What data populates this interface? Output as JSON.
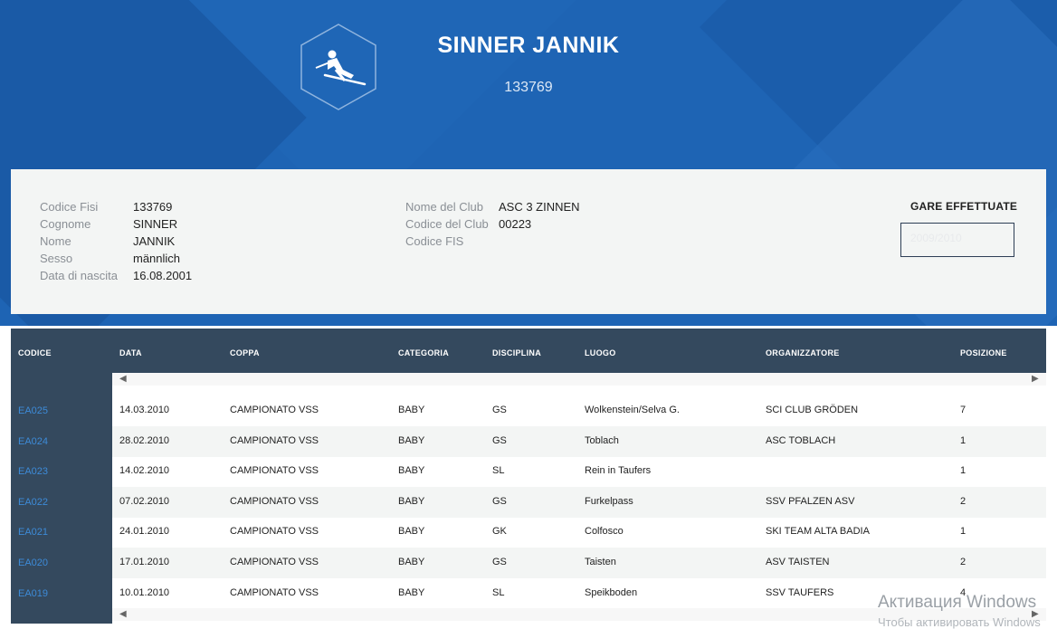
{
  "header": {
    "athlete_name": "SINNER JANNIK",
    "athlete_code": "133769"
  },
  "info": {
    "left": [
      {
        "label": "Codice Fisi",
        "value": "133769"
      },
      {
        "label": "Cognome",
        "value": "SINNER"
      },
      {
        "label": "Nome",
        "value": "JANNIK"
      },
      {
        "label": "Sesso",
        "value": "männlich"
      },
      {
        "label": "Data di nascita",
        "value": "16.08.2001"
      }
    ],
    "middle": [
      {
        "label": "Nome del Club",
        "value": "ASC 3 ZINNEN"
      },
      {
        "label": "Codice del Club",
        "value": "00223"
      },
      {
        "label": "Codice FIS",
        "value": ""
      }
    ],
    "gare_title": "GARE EFFETTUATE",
    "season_selected": "2009/2010"
  },
  "table": {
    "columns": [
      "CODICE",
      "DATA",
      "COPPA",
      "CATEGORIA",
      "DISCIPLINA",
      "LUOGO",
      "ORGANIZZATORE",
      "POSIZIONE"
    ],
    "rows": [
      {
        "codice": "EA025",
        "data": "14.03.2010",
        "coppa": "CAMPIONATO VSS",
        "categoria": "BABY",
        "disciplina": "GS",
        "luogo": "Wolkenstein/Selva G.",
        "organizzatore": "SCI CLUB GRÖDEN",
        "posizione": "7"
      },
      {
        "codice": "EA024",
        "data": "28.02.2010",
        "coppa": "CAMPIONATO VSS",
        "categoria": "BABY",
        "disciplina": "GS",
        "luogo": "Toblach",
        "organizzatore": "ASC TOBLACH",
        "posizione": "1"
      },
      {
        "codice": "EA023",
        "data": "14.02.2010",
        "coppa": "CAMPIONATO VSS",
        "categoria": "BABY",
        "disciplina": "SL",
        "luogo": "Rein in Taufers",
        "organizzatore": "",
        "posizione": "1"
      },
      {
        "codice": "EA022",
        "data": "07.02.2010",
        "coppa": "CAMPIONATO VSS",
        "categoria": "BABY",
        "disciplina": "GS",
        "luogo": "Furkelpass",
        "organizzatore": "SSV PFALZEN ASV",
        "posizione": "2"
      },
      {
        "codice": "EA021",
        "data": "24.01.2010",
        "coppa": "CAMPIONATO VSS",
        "categoria": "BABY",
        "disciplina": "GK",
        "luogo": "Colfosco",
        "organizzatore": "SKI TEAM ALTA BADIA",
        "posizione": "1"
      },
      {
        "codice": "EA020",
        "data": "17.01.2010",
        "coppa": "CAMPIONATO VSS",
        "categoria": "BABY",
        "disciplina": "GS",
        "luogo": "Taisten",
        "organizzatore": "ASV TAISTEN",
        "posizione": "2"
      },
      {
        "codice": "EA019",
        "data": "10.01.2010",
        "coppa": "CAMPIONATO VSS",
        "categoria": "BABY",
        "disciplina": "SL",
        "luogo": "Speikboden",
        "organizzatore": "SSV TAUFERS",
        "posizione": "4"
      }
    ]
  },
  "os_watermark": {
    "line1": "Активация Windows",
    "line2": "Чтобы активировать Windows"
  },
  "colors": {
    "hero_blue": "#1e64b4",
    "table_header": "#34495e",
    "link_blue": "#3d8bd8",
    "row_alt": "#f3f5f4"
  }
}
